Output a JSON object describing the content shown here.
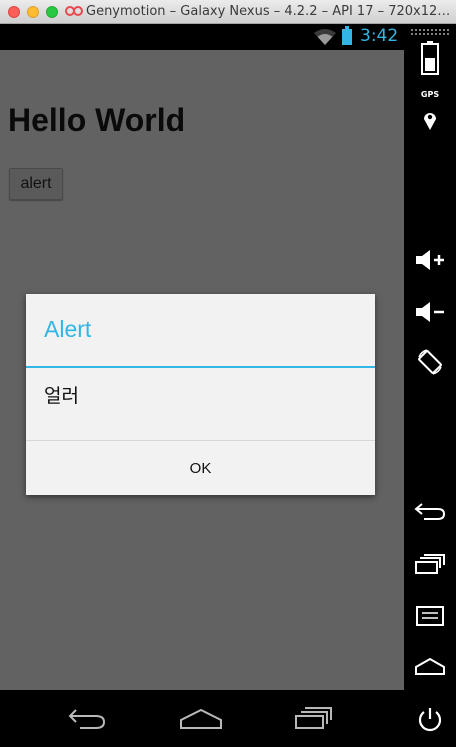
{
  "window": {
    "title": "Genymotion – Galaxy Nexus – 4.2.2 – API 17 – 720x12…"
  },
  "statusbar": {
    "time": "3:42",
    "accent": "#33b5e5"
  },
  "app": {
    "heading": "Hello World",
    "button_label": "alert",
    "background": "#626262"
  },
  "dialog": {
    "title": "Alert",
    "message": "얼러",
    "ok_label": "OK",
    "title_color": "#33b5e5"
  },
  "navbar": {
    "icons": [
      "back-icon",
      "home-icon",
      "recent-apps-icon"
    ]
  },
  "sidebar": {
    "gps_label": "GPS",
    "icons": [
      "battery-icon",
      "gps-icon",
      "volume-up-icon",
      "volume-down-icon",
      "rotate-icon",
      "back-icon",
      "recent-apps-icon",
      "menu-icon",
      "home-icon",
      "power-icon"
    ]
  }
}
